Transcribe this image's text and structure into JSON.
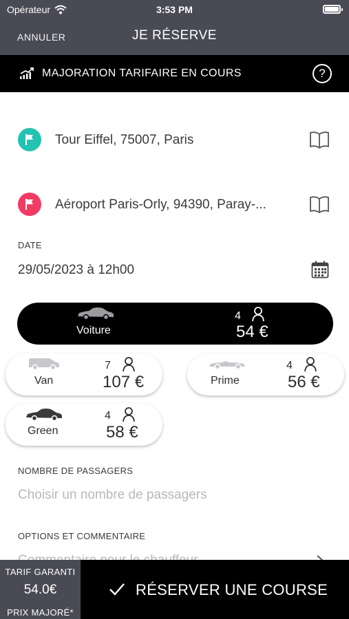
{
  "status": {
    "carrier": "Opérateur",
    "time": "3:53 PM"
  },
  "nav": {
    "cancel_label": "ANNULER",
    "title": "JE RÉSERVE"
  },
  "surge": {
    "text": "MAJORATION TARIFAIRE EN COURS",
    "help_label": "?"
  },
  "pickup": {
    "address": "Tour Eiffel, 75007, Paris",
    "color": "#22c3b0"
  },
  "dropoff": {
    "address": "Aéroport Paris-Orly, 94390, Paray-...",
    "color": "#f23a63"
  },
  "date": {
    "label": "DATE",
    "value": "29/05/2023 à 12h00"
  },
  "vehicles": [
    {
      "name": "Voiture",
      "seats": "4",
      "price": "54 €",
      "selected": true
    },
    {
      "name": "Van",
      "seats": "7",
      "price": "107 €",
      "selected": false
    },
    {
      "name": "Prime",
      "seats": "4",
      "price": "56 €",
      "selected": false
    },
    {
      "name": "Green",
      "seats": "4",
      "price": "58 €",
      "selected": false
    }
  ],
  "passengers": {
    "label": "NOMBRE DE PASSAGERS",
    "placeholder": "Choisir un nombre de passagers"
  },
  "options": {
    "label": "OPTIONS ET COMMENTAIRE",
    "placeholder": "Commentaire pour le chauffeur"
  },
  "footer": {
    "tarif_label": "TARIF GARANTI",
    "tarif_value": "54.0€",
    "tarif_sub": "PRIX MAJORÉ*",
    "reserve_label": "RÉSERVER UNE COURSE"
  },
  "colors": {
    "header": "#4a4a55",
    "banner": "#000000",
    "accent_pickup": "#22c3b0",
    "accent_dropoff": "#f23a63"
  }
}
